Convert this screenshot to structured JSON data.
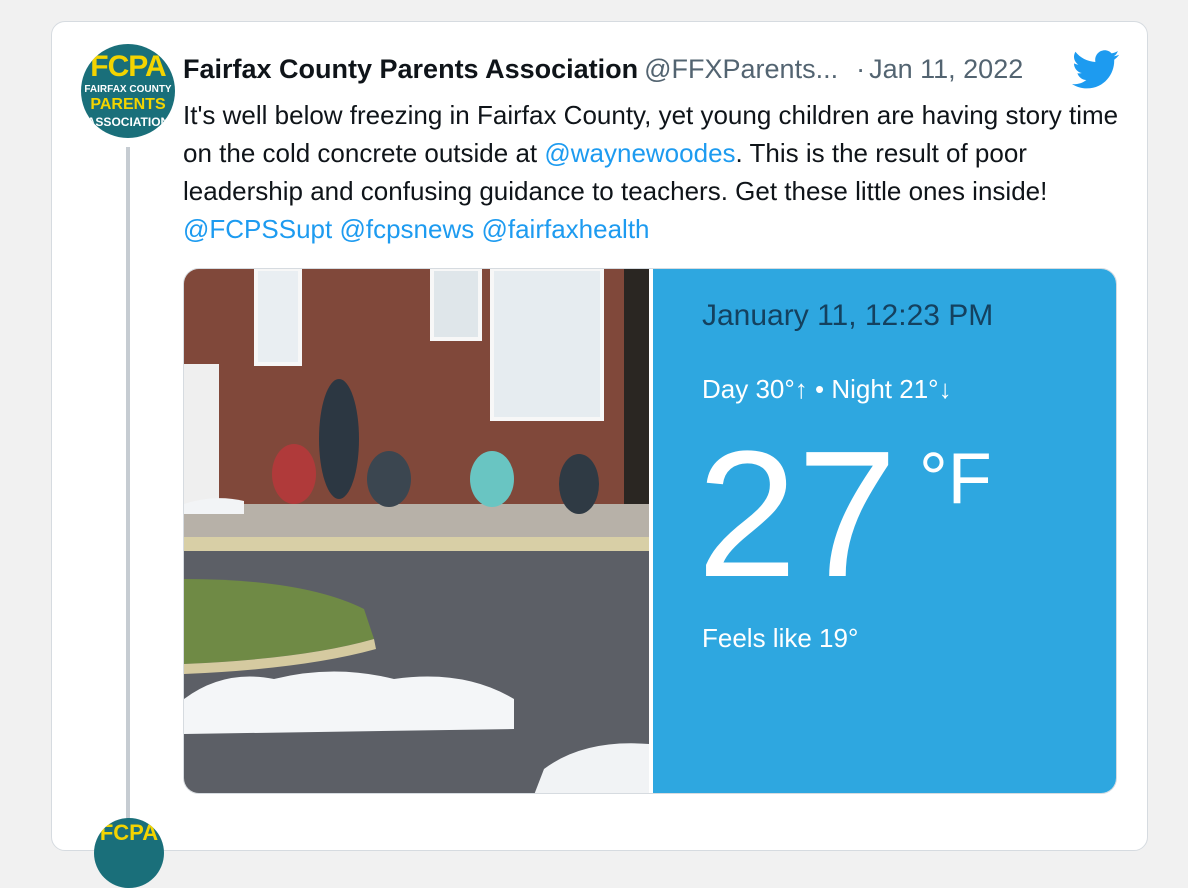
{
  "avatar": {
    "logo_big": "FCPA",
    "logo_line2": "FAIRFAX COUNTY",
    "logo_line3": "PARENTS",
    "logo_line4": "ASSOCIATION"
  },
  "tweet": {
    "author_name": "Fairfax County Parents Association",
    "handle": "@FFXParents...",
    "separator": "·",
    "date": "Jan 11, 2022",
    "text_1": "It's well below freezing in Fairfax County, yet young children are having story time on the cold concrete outside at ",
    "mention_1": "@waynewoodes",
    "text_2": ".  This is the result of poor leadership and confusing guidance to teachers. Get these little ones inside!  ",
    "mention_2": "@FCPSSupt",
    "mention_3": "@fcpsnews",
    "mention_4": "@fairfaxhealth"
  },
  "weather": {
    "date_time": "January 11, 12:23 PM",
    "day_night": "Day 30°↑ • Night 21°↓",
    "temperature": "27",
    "unit": "°F",
    "feels_like": "Feels like 19°"
  },
  "icons": {
    "twitter": "twitter-bird-icon"
  },
  "colors": {
    "link": "#1d9bf0",
    "weather_bg": "#2ea7e0",
    "avatar_bg": "#1a6f7a",
    "avatar_accent": "#f3d400",
    "twitter_blue": "#1d9bf0"
  }
}
